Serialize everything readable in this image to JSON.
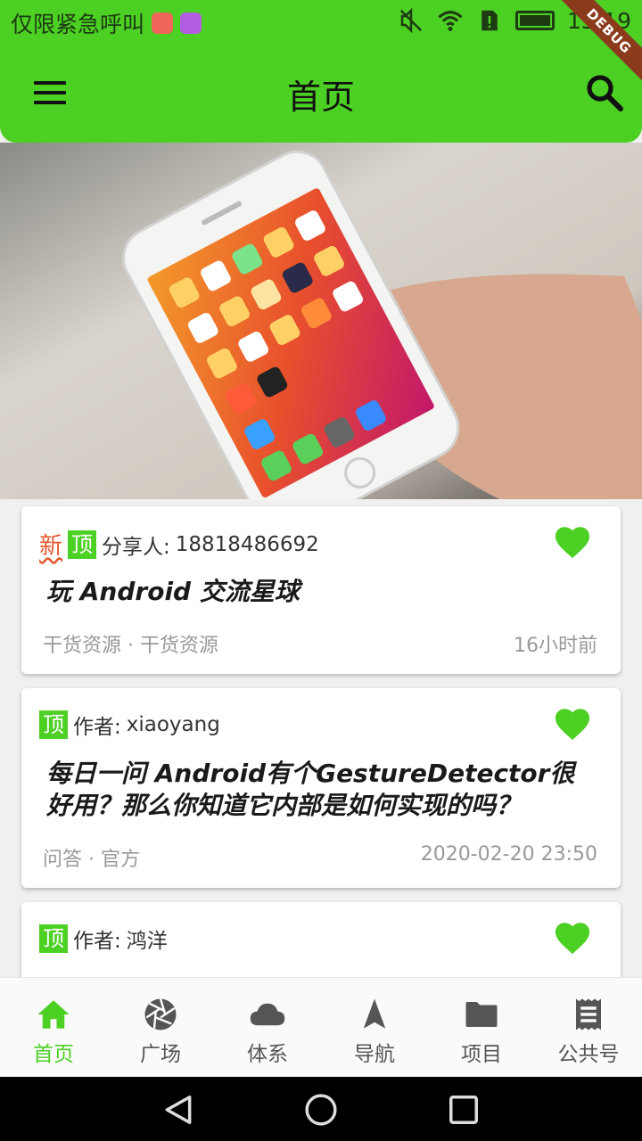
{
  "status_bar": {
    "carrier": "仅限紧急呼叫",
    "time": "15:19",
    "debug_label": "DEBUG"
  },
  "app_bar": {
    "title": "首页",
    "menu_icon": "menu-icon",
    "search_icon": "search-icon"
  },
  "colors": {
    "primary": "#4cd023",
    "tag_new": "#e4572e",
    "heart": "#4cd023"
  },
  "articles": [
    {
      "tag_new": "新",
      "tag_top": "顶",
      "author_label": "分享人:",
      "author": "18818486692",
      "title": "玩  Android  交流星球",
      "meta": "干货资源 · 干货资源",
      "time": "16小时前",
      "liked": true
    },
    {
      "tag_top": "顶",
      "author_label": "作者:",
      "author": "xiaoyang",
      "title": "每日一问  Android有个GestureDetector很好用？那么你知道它内部是如何实现的吗？",
      "meta": "问答 · 官方",
      "time": "2020-02-20  23:50",
      "liked": true
    },
    {
      "tag_top": "顶",
      "author_label": "作者:",
      "author": "鸿洋",
      "liked": true
    }
  ],
  "bottom_nav": [
    {
      "label": "首页",
      "icon": "home-icon",
      "active": true
    },
    {
      "label": "广场",
      "icon": "aperture-icon",
      "active": false
    },
    {
      "label": "体系",
      "icon": "cloud-icon",
      "active": false
    },
    {
      "label": "导航",
      "icon": "navigation-icon",
      "active": false
    },
    {
      "label": "项目",
      "icon": "folder-icon",
      "active": false
    },
    {
      "label": "公共号",
      "icon": "receipt-icon",
      "active": false
    }
  ]
}
